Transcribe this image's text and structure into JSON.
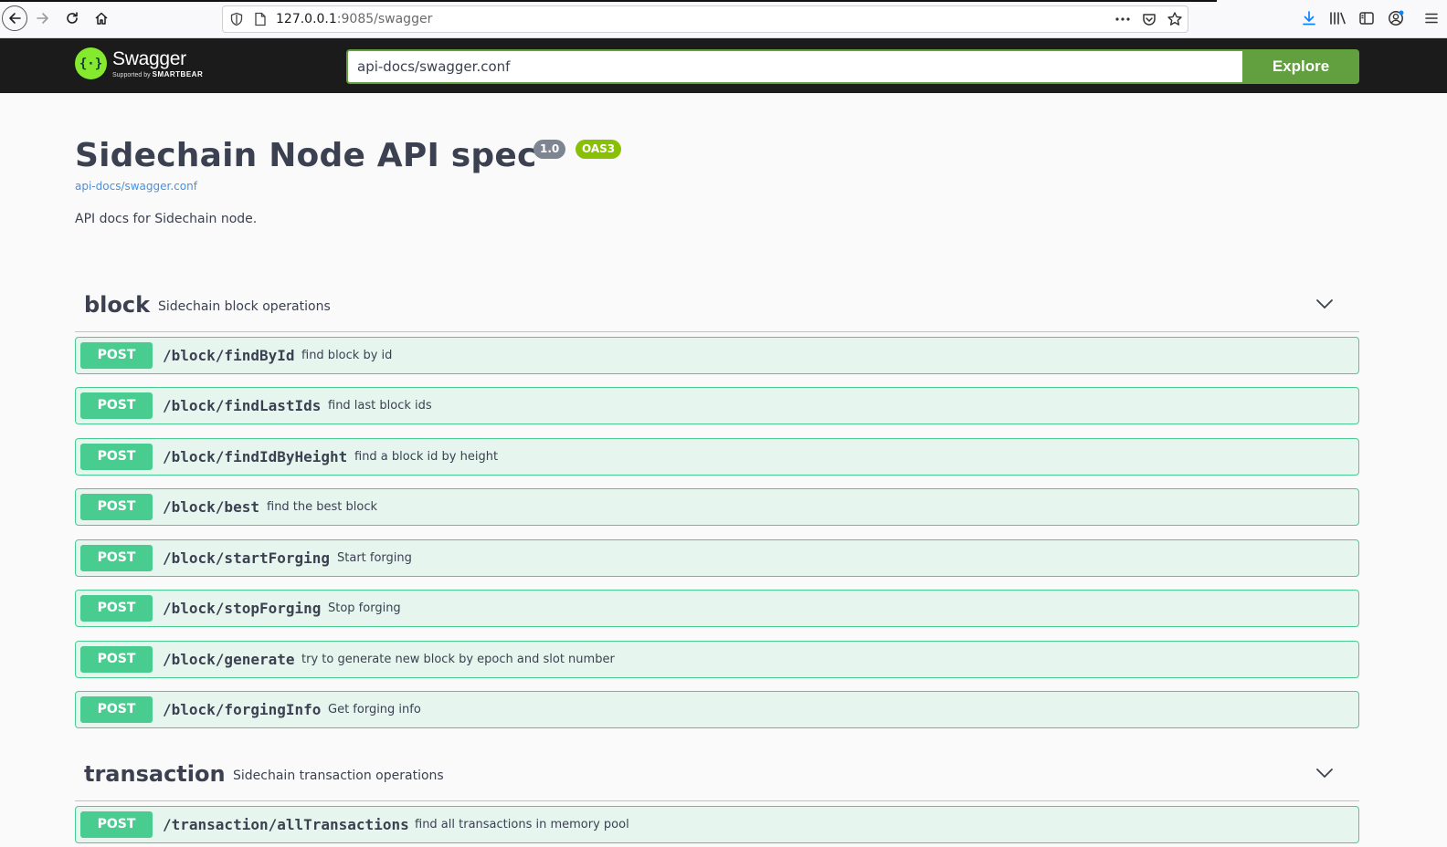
{
  "browser": {
    "url_host": "127.0.0.1",
    "url_rest": ":9085/swagger"
  },
  "topbar": {
    "logo_brand": "Swagger",
    "logo_support_prefix": "Supported by",
    "logo_support_brand": "SMARTBEAR",
    "explore_value": "api-docs/swagger.conf",
    "explore_label": "Explore",
    "accent": "#62a03f"
  },
  "info": {
    "title": "Sidechain Node API spec",
    "version": "1.0",
    "oas_badge": "OAS3",
    "url": "api-docs/swagger.conf",
    "description": "API docs for Sidechain node."
  },
  "tags": [
    {
      "name": "block",
      "description": "Sidechain block operations",
      "operations": [
        {
          "method": "POST",
          "path": "/block/findById",
          "summary": "find block by id"
        },
        {
          "method": "POST",
          "path": "/block/findLastIds",
          "summary": "find last block ids"
        },
        {
          "method": "POST",
          "path": "/block/findIdByHeight",
          "summary": "find a block id by height"
        },
        {
          "method": "POST",
          "path": "/block/best",
          "summary": "find the best block"
        },
        {
          "method": "POST",
          "path": "/block/startForging",
          "summary": "Start forging"
        },
        {
          "method": "POST",
          "path": "/block/stopForging",
          "summary": "Stop forging"
        },
        {
          "method": "POST",
          "path": "/block/generate",
          "summary": "try to generate new block by epoch and slot number"
        },
        {
          "method": "POST",
          "path": "/block/forgingInfo",
          "summary": "Get forging info"
        }
      ]
    },
    {
      "name": "transaction",
      "description": "Sidechain transaction operations",
      "operations": [
        {
          "method": "POST",
          "path": "/transaction/allTransactions",
          "summary": "find all transactions in memory pool"
        }
      ]
    }
  ],
  "colors": {
    "post": "#49cc90",
    "text": "#3b4151",
    "link": "#4990e2"
  }
}
